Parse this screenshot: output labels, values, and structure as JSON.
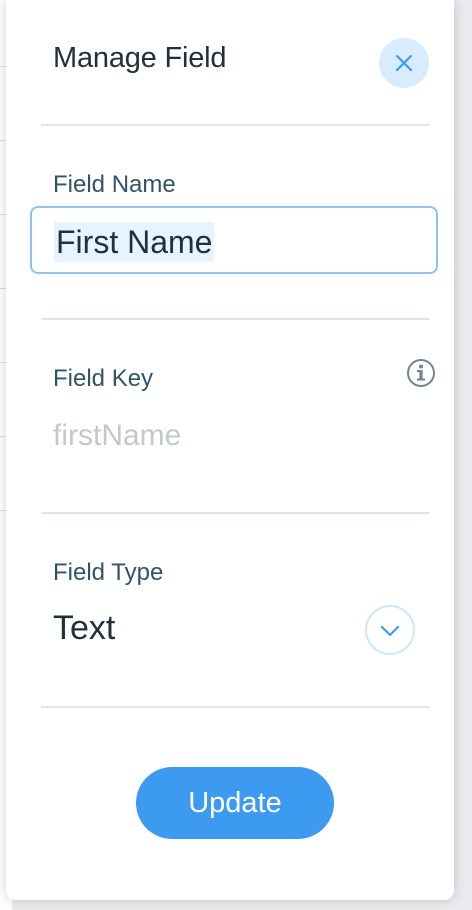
{
  "dialog": {
    "title": "Manage Field",
    "close_icon": "close-icon"
  },
  "field_name": {
    "label": "Field Name",
    "value": "First Name"
  },
  "field_key": {
    "label": "Field Key",
    "value": "firstName",
    "info_icon": "info-icon"
  },
  "field_type": {
    "label": "Field Type",
    "value": "Text",
    "dropdown_icon": "chevron-down-icon"
  },
  "actions": {
    "update_label": "Update"
  },
  "colors": {
    "accent": "#3d9af1",
    "close_bg": "#d9ecfd",
    "text_dark": "#20303c",
    "label": "#32536a",
    "placeholder": "#c3c8cd"
  }
}
